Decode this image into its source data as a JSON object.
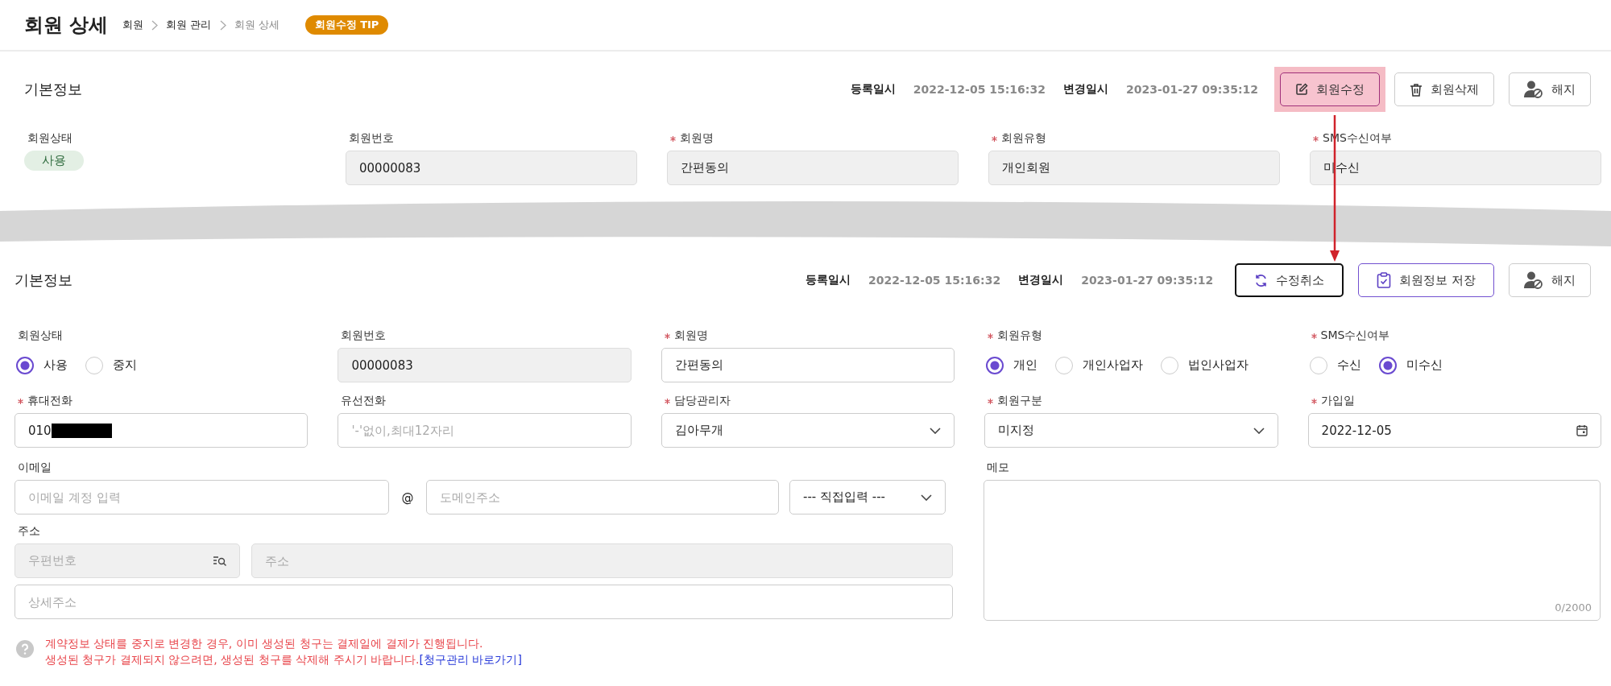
{
  "header": {
    "title": "회원 상세",
    "breadcrumb": [
      {
        "label": "회원",
        "current": false
      },
      {
        "label": "회원 관리",
        "current": false
      },
      {
        "label": "회원 상세",
        "current": true
      }
    ],
    "badge": "회원수정 TIP"
  },
  "view_panel": {
    "title": "기본정보",
    "registered_label": "등록일시",
    "registered": "2022-12-05 15:16:32",
    "changed_label": "변경일시",
    "changed": "2023-01-27 09:35:12",
    "buttons": [
      {
        "label": "회원수정",
        "kind": "edit",
        "highlighted": true
      },
      {
        "label": "회원삭제",
        "kind": "delete",
        "highlighted": false
      },
      {
        "label": "해지",
        "kind": "terminate",
        "highlighted": false
      }
    ],
    "fields": [
      {
        "label": "회원상태",
        "required": false,
        "kind": "badge",
        "value": "사용"
      },
      {
        "label": "회원번호",
        "required": false,
        "kind": "readonly",
        "value": "00000083"
      },
      {
        "label": "회원명",
        "required": true,
        "kind": "readonly",
        "value": "간편동의"
      },
      {
        "label": "회원유형",
        "required": true,
        "kind": "readonly",
        "value": "개인회원"
      },
      {
        "label": "SMS수신여부",
        "required": true,
        "kind": "readonly",
        "value": "미수신"
      }
    ]
  },
  "edit_panel": {
    "title": "기본정보",
    "registered_label": "등록일시",
    "registered": "2022-12-05 15:16:32",
    "changed_label": "변경일시",
    "changed": "2023-01-27 09:35:12",
    "buttons": [
      {
        "label": "수정취소",
        "kind": "cancel"
      },
      {
        "label": "회원정보 저장",
        "kind": "save"
      },
      {
        "label": "해지",
        "kind": "terminate"
      }
    ],
    "fields": [
      {
        "label": "회원상태",
        "required": false,
        "kind": "radio",
        "options": [
          {
            "label": "사용",
            "selected": true
          },
          {
            "label": "중지",
            "selected": false
          }
        ]
      },
      {
        "label": "회원번호",
        "required": false,
        "kind": "readonly",
        "value": "00000083"
      },
      {
        "label": "회원명",
        "required": true,
        "kind": "text",
        "value": "간편동의"
      },
      {
        "label": "회원유형",
        "required": true,
        "kind": "radio",
        "options": [
          {
            "label": "개인",
            "selected": true
          },
          {
            "label": "개인사업자",
            "selected": false
          },
          {
            "label": "법인사업자",
            "selected": false
          }
        ]
      },
      {
        "label": "SMS수신여부",
        "required": true,
        "kind": "radio",
        "options": [
          {
            "label": "수신",
            "selected": false
          },
          {
            "label": "미수신",
            "selected": true
          }
        ]
      },
      {
        "label": "휴대전화",
        "required": true,
        "kind": "text",
        "value": "010",
        "redacted": true
      },
      {
        "label": "유선전화",
        "required": false,
        "kind": "text",
        "placeholder": "'-'없이,최대12자리"
      },
      {
        "label": "담당관리자",
        "required": true,
        "kind": "select",
        "value": "김아무개"
      },
      {
        "label": "회원구분",
        "required": true,
        "kind": "select",
        "value": "미지정"
      },
      {
        "label": "가입일",
        "required": true,
        "kind": "date",
        "value": "2022-12-05"
      }
    ],
    "email": {
      "label": "이메일",
      "account_placeholder": "이메일 계정 입력",
      "at": "@",
      "domain_placeholder": "도메인주소",
      "domain_select": "--- 직접입력 ---"
    },
    "address": {
      "label": "주소",
      "zip_placeholder": "우편번호",
      "address_placeholder": "주소",
      "detail_placeholder": "상세주소"
    },
    "memo": {
      "label": "메모",
      "counter": "0/2000"
    },
    "notice": {
      "line_1": "계약정보 상태를 중지로 변경한 경우, 이미 생성된 청구는 결제일에 결제가 진행됩니다.",
      "line_2": "생성된 청구가 결제되지 않으려면, 생성된 청구를 삭제해 주시기 바랍니다.",
      "link": "[청구관리 바로가기]"
    }
  }
}
